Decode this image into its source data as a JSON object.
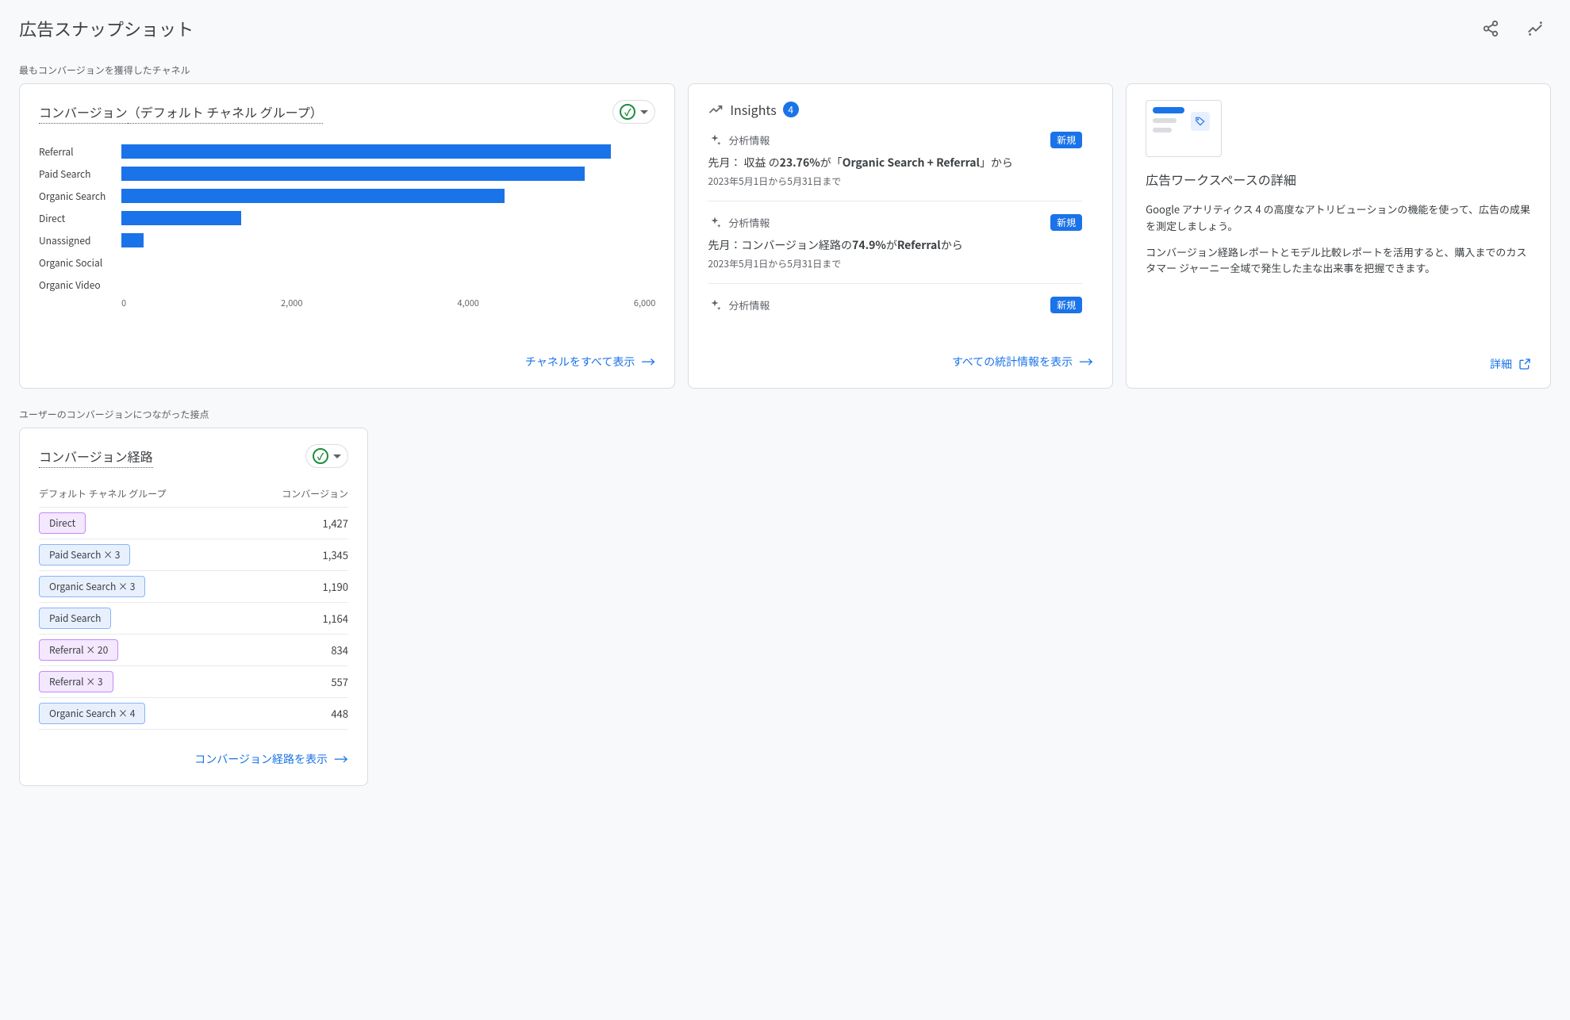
{
  "header": {
    "title": "広告スナップショット"
  },
  "section1_label": "最もコンバージョンを獲得したチャネル",
  "section2_label": "ユーザーのコンバージョンにつながった接点",
  "conversions_card": {
    "title_prefix": "コンバージョン",
    "title_suffix": "（デフォルト チャネル グループ）",
    "footer_link": "チャネルをすべて表示"
  },
  "chart_data": {
    "type": "bar",
    "orientation": "horizontal",
    "categories": [
      "Referral",
      "Paid Search",
      "Organic Search",
      "Direct",
      "Unassigned",
      "Organic Social",
      "Organic Video"
    ],
    "values": [
      5500,
      5200,
      4300,
      1350,
      250,
      0,
      0
    ],
    "xlim": [
      0,
      6000
    ],
    "xticks": [
      0,
      2000,
      4000,
      6000
    ],
    "xtick_labels": [
      "0",
      "2,000",
      "4,000",
      "6,000"
    ]
  },
  "insights_card": {
    "title": "Insights",
    "count": "4",
    "footer_link": "すべての統計情報を表示",
    "label_analysis": "分析情報",
    "new_label": "新規",
    "items": [
      {
        "text_pre": "先月： 収益 の",
        "text_bold": "23.76%",
        "text_mid": "が「",
        "text_bold2": "Organic Search + Referral",
        "text_post": "」から",
        "date": "2023年5月1日から5月31日まで"
      },
      {
        "text_pre": "先月：コンバージョン経路の",
        "text_bold": "74.9%",
        "text_mid": "が",
        "text_bold2": "Referral",
        "text_post": "から",
        "date": "2023年5月1日から5月31日まで"
      },
      {
        "text_pre": "",
        "text_bold": "",
        "text_mid": "",
        "text_bold2": "",
        "text_post": "",
        "date": ""
      }
    ]
  },
  "workspace_card": {
    "title": "広告ワークスペースの詳細",
    "para1": "Google アナリティクス 4 の高度なアトリビューションの機能を使って、広告の成果を測定しましょう。",
    "para2": "コンバージョン経路レポートとモデル比較レポートを活用すると、購入までのカスタマー ジャーニー全域で発生した主な出来事を把握できます。",
    "footer_link": "詳細"
  },
  "paths_card": {
    "title": "コンバージョン経路",
    "col1": "デフォルト チャネル グループ",
    "col2": "コンバージョン",
    "footer_link": "コンバージョン経路を表示",
    "rows": [
      {
        "label": "Direct",
        "count": "",
        "value": "1,427",
        "color": "purple"
      },
      {
        "label": "Paid Search",
        "count": "× 3",
        "value": "1,345",
        "color": "blue"
      },
      {
        "label": "Organic Search",
        "count": "× 3",
        "value": "1,190",
        "color": "blue"
      },
      {
        "label": "Paid Search",
        "count": "",
        "value": "1,164",
        "color": "blue"
      },
      {
        "label": "Referral",
        "count": "× 20",
        "value": "834",
        "color": "purple"
      },
      {
        "label": "Referral",
        "count": "× 3",
        "value": "557",
        "color": "purple"
      },
      {
        "label": "Organic Search",
        "count": "× 4",
        "value": "448",
        "color": "blue"
      }
    ]
  }
}
